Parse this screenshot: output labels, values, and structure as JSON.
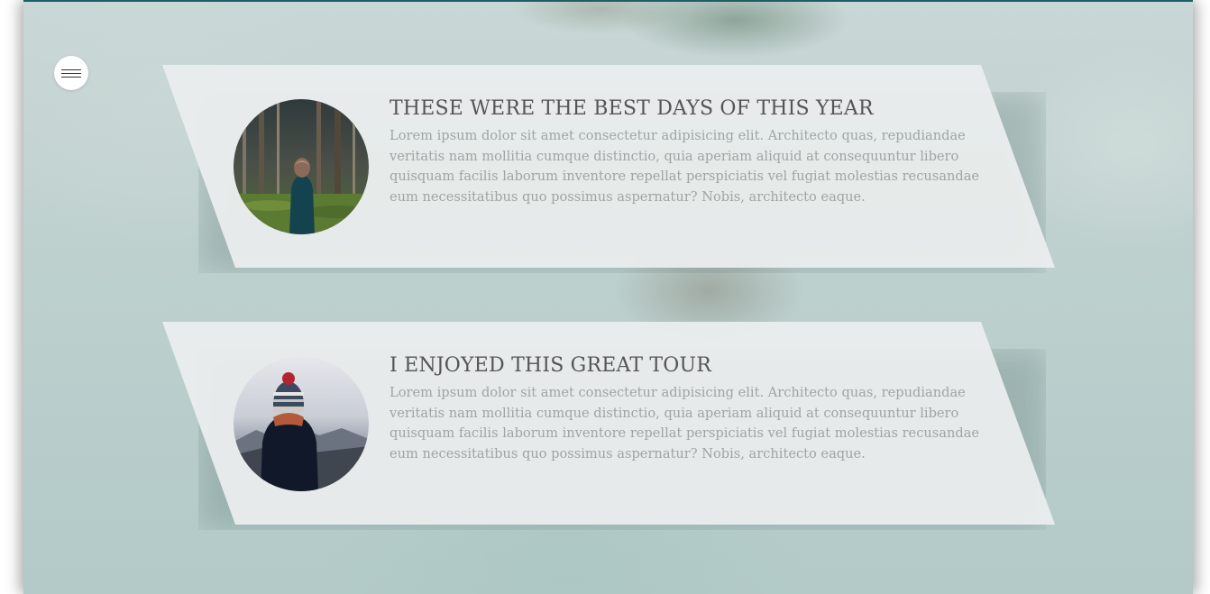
{
  "menu": {
    "icon": "hamburger-menu-icon"
  },
  "posts": [
    {
      "title": "THESE WERE THE BEST DAYS OF THIS YEAR",
      "text": "Lorem ipsum dolor sit amet consectetur adipisicing elit. Architecto quas, repudiandae veritatis nam mollitia cumque distinctio, quia aperiam aliquid at consequuntur libero quisquam facilis laborum inventore repellat perspiciatis vel fugiat molestias recusandae eum necessitatibus quo possimus aspernatur? Nobis, architecto eaque.",
      "image": "person-in-forest-photo"
    },
    {
      "title": "I ENJOYED THIS GREAT TOUR",
      "text": "Lorem ipsum dolor sit amet consectetur adipisicing elit. Architecto quas, repudiandae veritatis nam mollitia cumque distinctio, quia aperiam aliquid at consequuntur libero quisquam facilis laborum inventore repellat perspiciatis vel fugiat molestias recusandae eum necessitatibus quo possimus aspernatur? Nobis, architecto eaque.",
      "image": "person-in-winter-hat-photo"
    }
  ],
  "colors": {
    "accent_border": "#1d5f63",
    "card_background": "#eaeded",
    "title_text": "#555555",
    "body_text": "#a0a4a4"
  }
}
